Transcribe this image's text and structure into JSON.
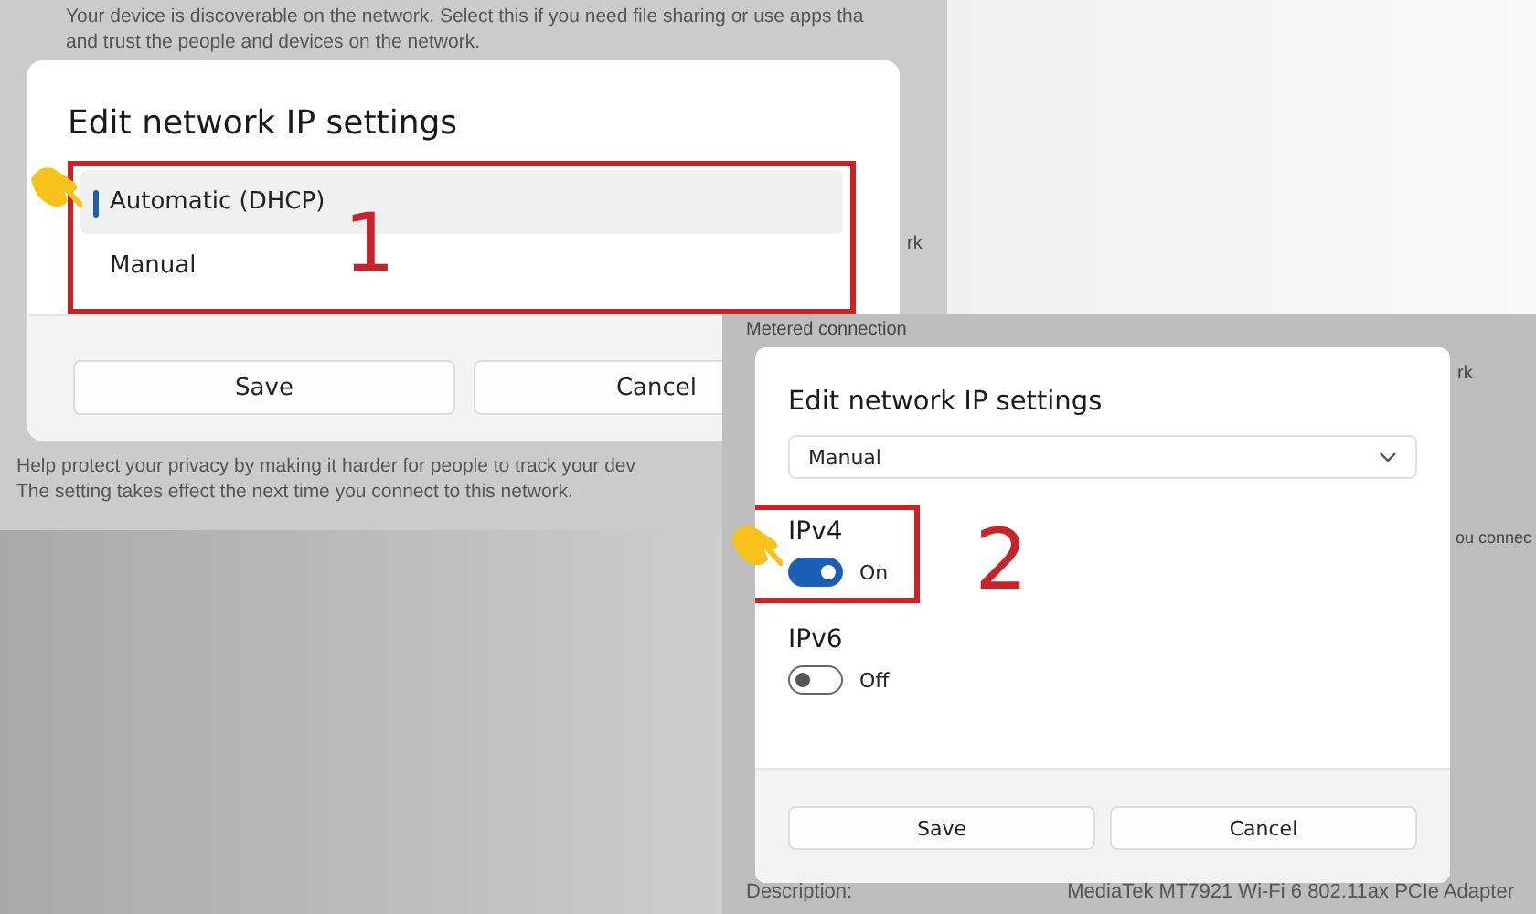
{
  "first_screen": {
    "background_lines": [
      "Your device is discoverable on the network. Select this if you need file sharing or use apps tha",
      "and trust the people and devices on the network."
    ],
    "fragment_right": "rk",
    "footer_lines": [
      "Help protect your privacy by making it harder for people to track your dev",
      "The setting takes effect the next time you connect to this network."
    ],
    "dialog": {
      "title": "Edit network IP settings",
      "options": [
        {
          "label": "Automatic (DHCP)",
          "selected": true
        },
        {
          "label": "Manual",
          "selected": false
        }
      ],
      "step": "1",
      "buttons": [
        "Save",
        "Cancel"
      ]
    }
  },
  "second_screen": {
    "top_line": "Metered connection",
    "fragment_right": "rk",
    "fragment_mid": "ou connec",
    "details": [
      {
        "label": "Description:",
        "value": "MediaTek MT7921 Wi-Fi 6 802.11ax PCIe Adapter"
      }
    ],
    "dialog": {
      "title": "Edit network IP settings",
      "dropdown": "Manual",
      "step": "2",
      "toggles": [
        {
          "label": "IPv4",
          "on": true,
          "state": "On",
          "highlighted": true
        },
        {
          "label": "IPv6",
          "on": false,
          "state": "Off",
          "highlighted": false
        }
      ],
      "buttons": [
        "Save",
        "Cancel"
      ]
    }
  }
}
